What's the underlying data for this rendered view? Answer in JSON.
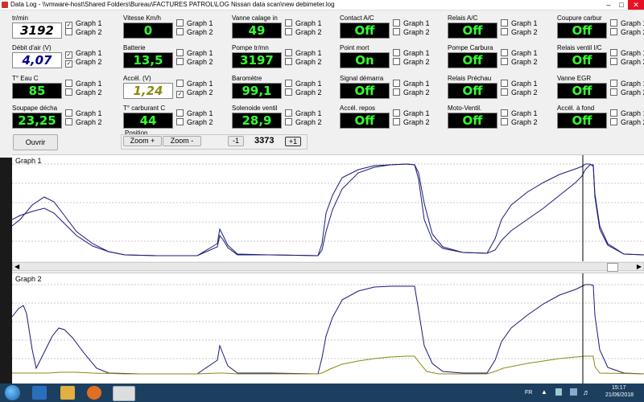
{
  "window": {
    "title": "Data Log - \\\\vmware-host\\Shared Folders\\Bureau\\FACTURES PATROL\\LOG Nissan data scan\\new debimeter.log"
  },
  "gauges": [
    {
      "label": "tr/min",
      "value": "3192",
      "style": "white",
      "g1": true,
      "g2": false
    },
    {
      "label": "Débit d'air (V)",
      "value": "4,07",
      "style": "blue",
      "g1": true,
      "g2": true
    },
    {
      "label": "T° Eau C",
      "value": "85",
      "style": "green",
      "g1": false,
      "g2": false
    },
    {
      "label": "Soupape décha",
      "value": "23,25",
      "style": "green",
      "g1": false,
      "g2": false
    },
    {
      "label": "Vitesse Km/h",
      "value": "0",
      "style": "green",
      "g1": false,
      "g2": false
    },
    {
      "label": "Batterie",
      "value": "13,5",
      "style": "green",
      "g1": false,
      "g2": false
    },
    {
      "label": "Accél. (V)",
      "value": "1,24",
      "style": "olive",
      "g1": false,
      "g2": true
    },
    {
      "label": "T° carburant C",
      "value": "44",
      "style": "green",
      "g1": false,
      "g2": false
    },
    {
      "label": "Vanne calage in",
      "value": "49",
      "style": "green",
      "g1": false,
      "g2": false
    },
    {
      "label": "Pompe tr/mn",
      "value": "3197",
      "style": "green",
      "g1": false,
      "g2": false
    },
    {
      "label": "Baromètre",
      "value": "99,1",
      "style": "green",
      "g1": false,
      "g2": false
    },
    {
      "label": "Solenoide ventil",
      "value": "28,9",
      "style": "green",
      "g1": false,
      "g2": false
    },
    {
      "label": "Contact A/C",
      "value": "Off",
      "style": "green",
      "g1": false,
      "g2": false
    },
    {
      "label": "Point mort",
      "value": "On",
      "style": "green",
      "g1": false,
      "g2": false
    },
    {
      "label": "Signal démarra",
      "value": "Off",
      "style": "green",
      "g1": false,
      "g2": false
    },
    {
      "label": "Accél. repos",
      "value": "Off",
      "style": "green",
      "g1": false,
      "g2": false
    },
    {
      "label": "Relais A/C",
      "value": "Off",
      "style": "green",
      "g1": false,
      "g2": false
    },
    {
      "label": "Pompe Carbura",
      "value": "Off",
      "style": "green",
      "g1": false,
      "g2": false
    },
    {
      "label": "Relais Préchau",
      "value": "Off",
      "style": "green",
      "g1": false,
      "g2": false
    },
    {
      "label": "Moto-Ventil.",
      "value": "Off",
      "style": "green",
      "g1": false,
      "g2": false
    },
    {
      "label": "Coupure carbur",
      "value": "Off",
      "style": "green",
      "g1": false,
      "g2": false
    },
    {
      "label": "Relais ventil I/C",
      "value": "Off",
      "style": "green",
      "g1": false,
      "g2": false
    },
    {
      "label": "Vanne EGR",
      "value": "Off",
      "style": "green",
      "g1": false,
      "g2": false
    },
    {
      "label": "Accél. à fond",
      "value": "Off",
      "style": "green",
      "g1": false,
      "g2": false
    }
  ],
  "checkbox_labels": {
    "g1": "Graph 1",
    "g2": "Graph 2"
  },
  "controls": {
    "open_label": "Ouvrir",
    "position_label": "Position",
    "zoom_in_label": "Zoom +",
    "zoom_out_label": "Zoom -",
    "step_back_label": "-1",
    "position_value": "3373",
    "step_fwd_label": "+1"
  },
  "graph1": {
    "title": "Graph 1",
    "series_color": "#1a1a7a"
  },
  "graph2": {
    "title": "Graph 2",
    "series_colors": [
      "#1a1a7a",
      "#8a8a10"
    ]
  },
  "taskbar": {
    "lang": "FR",
    "time": "15:17",
    "date": "21/06/2018"
  }
}
